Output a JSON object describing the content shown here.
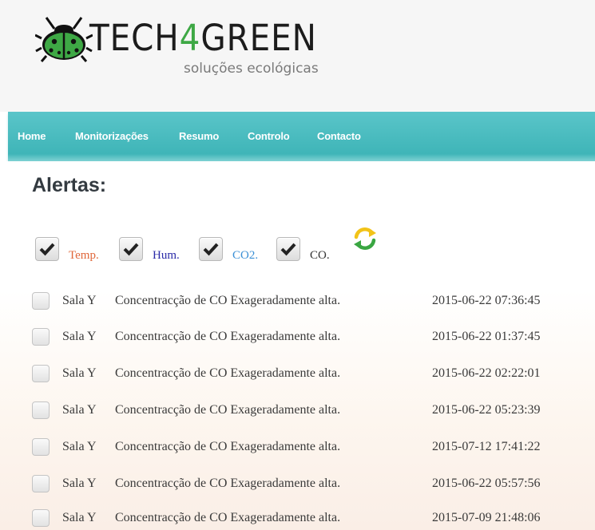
{
  "brand": {
    "name_prefix": "TECH",
    "name_accent": "4",
    "name_suffix": "GREEN",
    "tagline": "soluções ecológicas",
    "accent_color": "#3ea845",
    "logo_icon": "ladybug-logo-icon"
  },
  "nav": {
    "items": [
      {
        "label": "Home"
      },
      {
        "label": "Monitorizações"
      },
      {
        "label": "Resumo"
      },
      {
        "label": "Controlo"
      },
      {
        "label": "Contacto"
      }
    ],
    "background": "#49bcc0"
  },
  "alerts": {
    "title": "Alertas:",
    "filters": [
      {
        "label": "Temp.",
        "checked": true,
        "color": "#e0673a"
      },
      {
        "label": "Hum.",
        "checked": true,
        "color": "#2a2aa8"
      },
      {
        "label": "CO2.",
        "checked": true,
        "color": "#3a8fd6"
      },
      {
        "label": "CO.",
        "checked": true,
        "color": "#333333"
      }
    ],
    "refresh_icon": "refresh-icon",
    "rows": [
      {
        "room": "Sala Y",
        "message": "Concentracção de CO Exageradamente alta.",
        "timestamp": "2015-06-22 07:36:45",
        "checked": false
      },
      {
        "room": "Sala Y",
        "message": "Concentracção de CO Exageradamente alta.",
        "timestamp": "2015-06-22 01:37:45",
        "checked": false
      },
      {
        "room": "Sala Y",
        "message": "Concentracção de CO Exageradamente alta.",
        "timestamp": "2015-06-22 02:22:01",
        "checked": false
      },
      {
        "room": "Sala Y",
        "message": "Concentracção de CO Exageradamente alta.",
        "timestamp": "2015-06-22 05:23:39",
        "checked": false
      },
      {
        "room": "Sala Y",
        "message": "Concentracção de CO Exageradamente alta.",
        "timestamp": "2015-07-12 17:41:22",
        "checked": false
      },
      {
        "room": "Sala Y",
        "message": "Concentracção de CO Exageradamente alta.",
        "timestamp": "2015-06-22 05:57:56",
        "checked": false
      },
      {
        "room": "Sala Y",
        "message": "Concentracção de CO Exageradamente alta.",
        "timestamp": "2015-07-09 21:48:06",
        "checked": false
      }
    ]
  }
}
